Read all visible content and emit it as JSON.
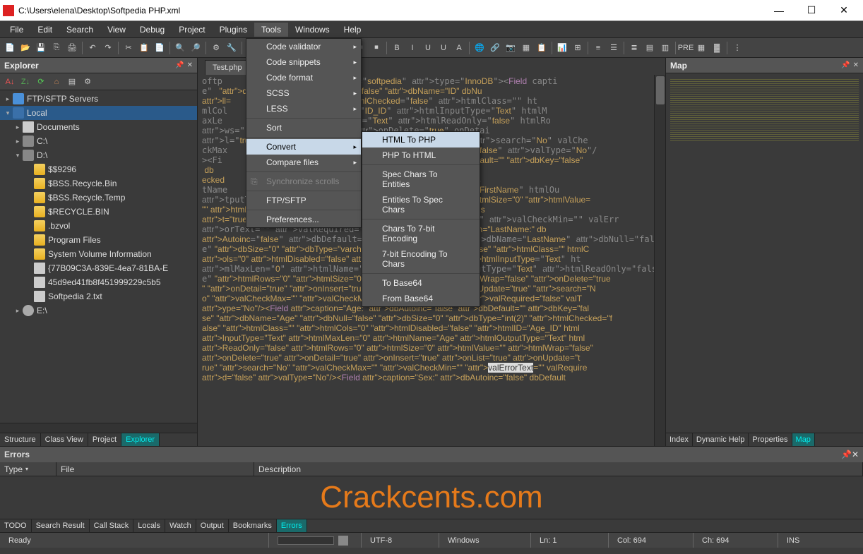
{
  "window": {
    "title": "C:\\Users\\elena\\Desktop\\Softpedia PHP.xml"
  },
  "menubar": [
    "File",
    "Edit",
    "Search",
    "View",
    "Debug",
    "Project",
    "Plugins",
    "Tools",
    "Windows",
    "Help"
  ],
  "menubar_active": "Tools",
  "tools_menu": [
    {
      "label": "Code validator",
      "sub": true
    },
    {
      "label": "Code snippets",
      "sub": true
    },
    {
      "label": "Code format",
      "sub": true
    },
    {
      "label": "SCSS",
      "sub": true
    },
    {
      "label": "LESS",
      "sub": true
    },
    {
      "label": "Sort"
    },
    {
      "label": "Convert",
      "sub": true,
      "hl": true
    },
    {
      "label": "Compare files",
      "sub": true
    },
    {
      "label": "Synchronize scrolls",
      "disabled": true,
      "icon": true
    },
    {
      "label": "FTP/SFTP"
    },
    {
      "label": "Preferences..."
    }
  ],
  "convert_menu": [
    {
      "label": "HTML To PHP",
      "hl": true
    },
    {
      "label": "PHP To HTML"
    },
    {
      "sep": true
    },
    {
      "label": "Spec Chars To Entities"
    },
    {
      "label": "Entities To Spec Chars"
    },
    {
      "sep": true
    },
    {
      "label": "Chars To 7-bit Encoding"
    },
    {
      "label": "7-bit Encoding To Chars"
    },
    {
      "sep": true
    },
    {
      "label": "To Base64"
    },
    {
      "label": "From Base64"
    }
  ],
  "explorer": {
    "title": "Explorer",
    "items": [
      {
        "label": "FTP/SFTP Servers",
        "icon": "server",
        "arrow": "▸",
        "indent": 0
      },
      {
        "label": "Local",
        "icon": "computer",
        "arrow": "▾",
        "indent": 0,
        "sel": true
      },
      {
        "label": "Documents",
        "icon": "file",
        "arrow": "▸",
        "indent": 1
      },
      {
        "label": "C:\\",
        "icon": "drive",
        "arrow": "▸",
        "indent": 1
      },
      {
        "label": "D:\\",
        "icon": "drive",
        "arrow": "▾",
        "indent": 1
      },
      {
        "label": "$$9296",
        "icon": "folder",
        "arrow": "",
        "indent": 2
      },
      {
        "label": "$BSS.Recycle.Bin",
        "icon": "folder",
        "arrow": "",
        "indent": 2
      },
      {
        "label": "$BSS.Recycle.Temp",
        "icon": "folder",
        "arrow": "",
        "indent": 2
      },
      {
        "label": "$RECYCLE.BIN",
        "icon": "folder",
        "arrow": "",
        "indent": 2
      },
      {
        "label": ".bzvol",
        "icon": "folder",
        "arrow": "",
        "indent": 2
      },
      {
        "label": "Program Files",
        "icon": "folder",
        "arrow": "",
        "indent": 2
      },
      {
        "label": "System Volume Information",
        "icon": "folder",
        "arrow": "",
        "indent": 2
      },
      {
        "label": "{77B09C3A-839E-4ea7-81BA-E",
        "icon": "file",
        "arrow": "",
        "indent": 2
      },
      {
        "label": "45d9ed41fb8f451999229c5b5",
        "icon": "file",
        "arrow": "",
        "indent": 2
      },
      {
        "label": "Softpedia 2.txt",
        "icon": "file",
        "arrow": "",
        "indent": 2
      },
      {
        "label": "E:\\",
        "icon": "cd",
        "arrow": "▸",
        "indent": 1
      }
    ],
    "tabs": [
      "Structure",
      "Class View",
      "Project",
      "Explorer"
    ],
    "active_tab": "Explorer"
  },
  "editor": {
    "tabs": [
      {
        "label": "Test.php"
      },
      {
        "label": "edia PHP.xml",
        "active": true,
        "partial": true
      }
    ],
    "lines": [
      "oftp            Table name=\"softpedia\" type=\"InnoDB\"><Field capti",
      "e\"   dbDefault=\"PRI\" dbKey=\"false\" dbName=\"ID\" dbNu",
      "ll=          oType=\"int(2)\" htmlChecked=\"false\" htmlClass=\"\" ht",
      "mlCol       =\"false\" htmlID=\"ID_ID\" htmlInputType=\"Text\" htmlM",
      "axLe         htmlOutputType=\"Text\" htmlReadOnly=\"false\" htmlRo",
      "ws=\"                                       se\" onDelete=\"true\" onDetai",
      "l=\"true\"                                   =\"true\" search=\"No\" valChe",
      "ckMax                                      uired=\"false\" valType=\"No\"/",
      "><Fi                                       e\" dbDefault=\"\" dbKey=\"false\"",
      " db                                        dbType=\"varchar(10)\" htmlCh",
      "ecked                                      sabled=\"false\" htmlID=\"Firs",
      "tName                                      lName=\"FirstName\" htmlOu",
      "tputType=\"Text\" htmlRea                    0\" htmlSize=\"0\" htmlValue=",
      "\"\" htmlWrap=\"false\" onDe                   true\" onInsert=\"true\" onLis",
      "t=\"true\" onUpdate=\"true\"                   ax=\"\" valCheckMin=\"\" valErr",
      "orText=\"\" valRequired=\"                    Field caption=\"LastName:\" db",
      "Autoinc=\"false\" dbDefault=\"\" dbKey=\"false\" dbName=\"LastName\" dbNull=\"fals",
      "e\" dbSize=\"0\" dbType=\"varchar(10)\" htmlChecked=\"false\" htmlClass=\"\" htmlC",
      "ols=\"0\" htmlDisabled=\"false\" htmlID=\"LastName_ID\" htmlInputType=\"Text\" ht",
      "mlMaxLen=\"0\" htmlName=\"LastName\" htmlOutputType=\"Text\" htmlReadOnly=\"fals",
      "e\" htmlRows=\"0\" htmlSize=\"0\" htmlValue=\"\" htmlWrap=\"false\" onDelete=\"true",
      "\" onDetail=\"true\" onInsert=\"true\" onList=\"true\" onUpdate=\"true\" search=\"N",
      "o\" valCheckMax=\"\" valCheckMin=\"\" valErrorText=\"\" valRequired=\"false\" valT",
      "ype=\"No\"/><Field caption=\"Age:\" dbAutoinc=\"false\" dbDefault=\"\" dbKey=\"fal",
      "se\" dbName=\"Age\" dbNull=\"false\" dbSize=\"0\" dbType=\"int(2)\" htmlChecked=\"f",
      "alse\" htmlClass=\"\" htmlCols=\"0\" htmlDisabled=\"false\" htmlID=\"Age_ID\" html",
      "InputType=\"Text\" htmlMaxLen=\"0\" htmlName=\"Age\" htmlOutputType=\"Text\" html",
      "ReadOnly=\"false\" htmlRows=\"0\" htmlSize=\"0\" htmlValue=\"\" htmlWrap=\"false\" ",
      "onDelete=\"true\" onDetail=\"true\" onInsert=\"true\" onList=\"true\" onUpdate=\"t",
      "rue\" search=\"No\" valCheckMax=\"\" valCheckMin=\"\" valErrorText=\"\" valRequire",
      "d=\"false\" valType=\"No\"/><Field caption=\"Sex:\" dbAutoinc=\"false\" dbDefault"
    ]
  },
  "map": {
    "title": "Map",
    "tabs": [
      "Index",
      "Dynamic Help",
      "Properties",
      "Map"
    ],
    "active_tab": "Map"
  },
  "errors": {
    "title": "Errors",
    "columns": [
      "Type",
      "File",
      "Description"
    ]
  },
  "bottom_tabs": [
    "TODO",
    "Search Result",
    "Call Stack",
    "Locals",
    "Watch",
    "Output",
    "Bookmarks",
    "Errors"
  ],
  "bottom_active": "Errors",
  "watermark": "Crackcents.com",
  "status": {
    "ready": "Ready",
    "encoding": "UTF-8",
    "eol": "Windows",
    "line": "Ln: 1",
    "col": "Col: 694",
    "ch": "Ch: 694",
    "ins": "INS"
  }
}
